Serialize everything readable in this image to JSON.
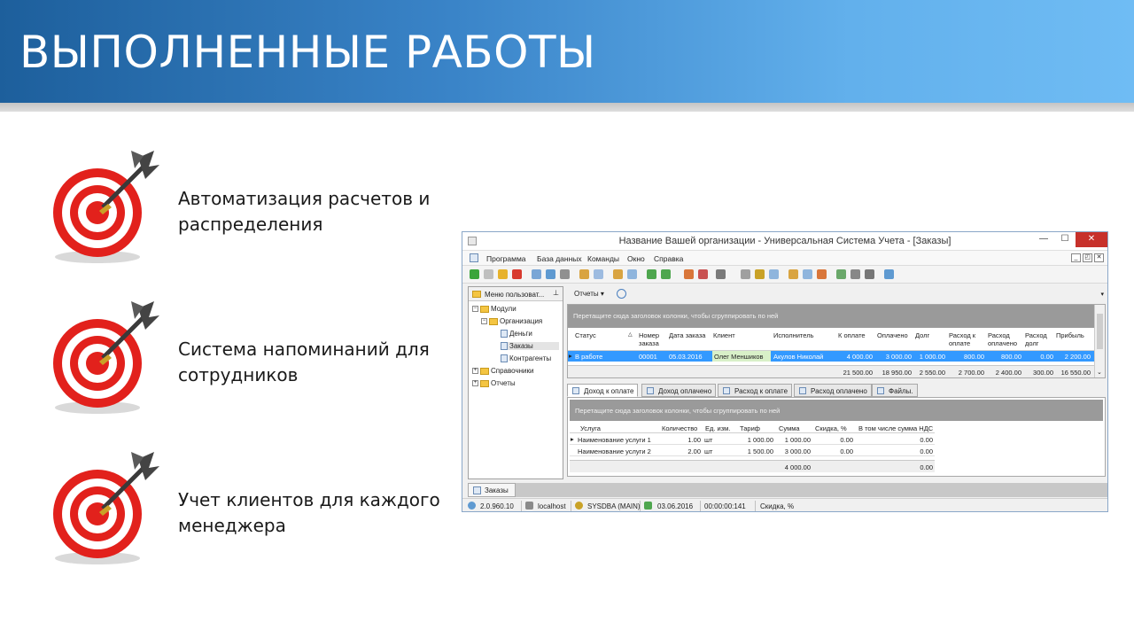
{
  "slide": {
    "title": "ВЫПОЛНЕННЫЕ РАБОТЫ",
    "bullets": [
      {
        "line1": "Автоматизация расчетов и",
        "line2": "распределения"
      },
      {
        "line1": "Система напоминаний для",
        "line2": "сотрудников"
      },
      {
        "line1": "Учет клиентов для каждого",
        "line2": "менеджера"
      }
    ]
  },
  "app": {
    "window_title": "Название Вашей организации - Универсальная Система Учета - [Заказы]",
    "window_buttons": {
      "minimize": "—",
      "maximize": "☐",
      "close": "✕"
    },
    "menu": [
      "Программа",
      "База данных",
      "Команды",
      "Окно",
      "Справка"
    ],
    "mdi_buttons": [
      "_",
      "◰",
      "✕"
    ],
    "sidebar": {
      "header": "Меню пользоват...",
      "tree": [
        {
          "label": "Модули",
          "kind": "folder",
          "level": 0,
          "expander": "−"
        },
        {
          "label": "Организация",
          "kind": "folder",
          "level": 1,
          "expander": "−"
        },
        {
          "label": "Деньги",
          "kind": "doc",
          "level": 2
        },
        {
          "label": "Заказы",
          "kind": "doc",
          "level": 2,
          "selected": true
        },
        {
          "label": "Контрагенты",
          "kind": "doc",
          "level": 2
        },
        {
          "label": "Справочники",
          "kind": "folder",
          "level": 0,
          "expander": "+"
        },
        {
          "label": "Отчеты",
          "kind": "folder",
          "level": 0,
          "expander": "+"
        }
      ]
    },
    "reports_button": "Отчеты",
    "orders_grid": {
      "group_hint": "Перетащите сюда заголовок колонки, чтобы сгруппировать по ней",
      "columns": [
        "Статус",
        "Номер заказа",
        "Дата заказа",
        "Клиент",
        "Исполнитель",
        "К оплате",
        "Оплачено",
        "Долг",
        "Расход к оплате",
        "Расход оплачено",
        "Расход долг",
        "Прибыль"
      ],
      "rows": [
        [
          "В работе",
          "00001",
          "05.03.2016",
          "Олег Меншиков",
          "Акулов Николай",
          "4 000.00",
          "3 000.00",
          "1 000.00",
          "800.00",
          "800.00",
          "0.00",
          "2 200.00"
        ]
      ],
      "totals": [
        "21 500.00",
        "18 950.00",
        "2 550.00",
        "2 700.00",
        "2 400.00",
        "300.00",
        "16 550.00"
      ]
    },
    "detail_tabs": [
      "Доход к оплате",
      "Доход оплачено",
      "Расход к оплате",
      "Расход оплачено",
      "Файлы."
    ],
    "detail_grid": {
      "group_hint": "Перетащите сюда заголовок колонки, чтобы сгруппировать по ней",
      "columns": [
        "Услуга",
        "Количество",
        "Ед. изм.",
        "Тариф",
        "Сумма",
        "Скидка, %",
        "В том числе сумма НДС"
      ],
      "rows": [
        [
          "Наименование услуги 1",
          "1.00",
          "шт",
          "1 000.00",
          "1 000.00",
          "0.00",
          "0.00"
        ],
        [
          "Наименование услуги 2",
          "2.00",
          "шт",
          "1 500.00",
          "3 000.00",
          "0.00",
          "0.00"
        ]
      ],
      "totals": {
        "sum": "4 000.00",
        "vat": "0.00"
      }
    },
    "bottom_tab": "Заказы",
    "status": {
      "version": "2.0.960.10",
      "host": "localhost",
      "user": "SYSDBA (MAIN)",
      "date": "03.06.2016",
      "time": "00:00:00:141",
      "field": "Скидка, %"
    }
  }
}
